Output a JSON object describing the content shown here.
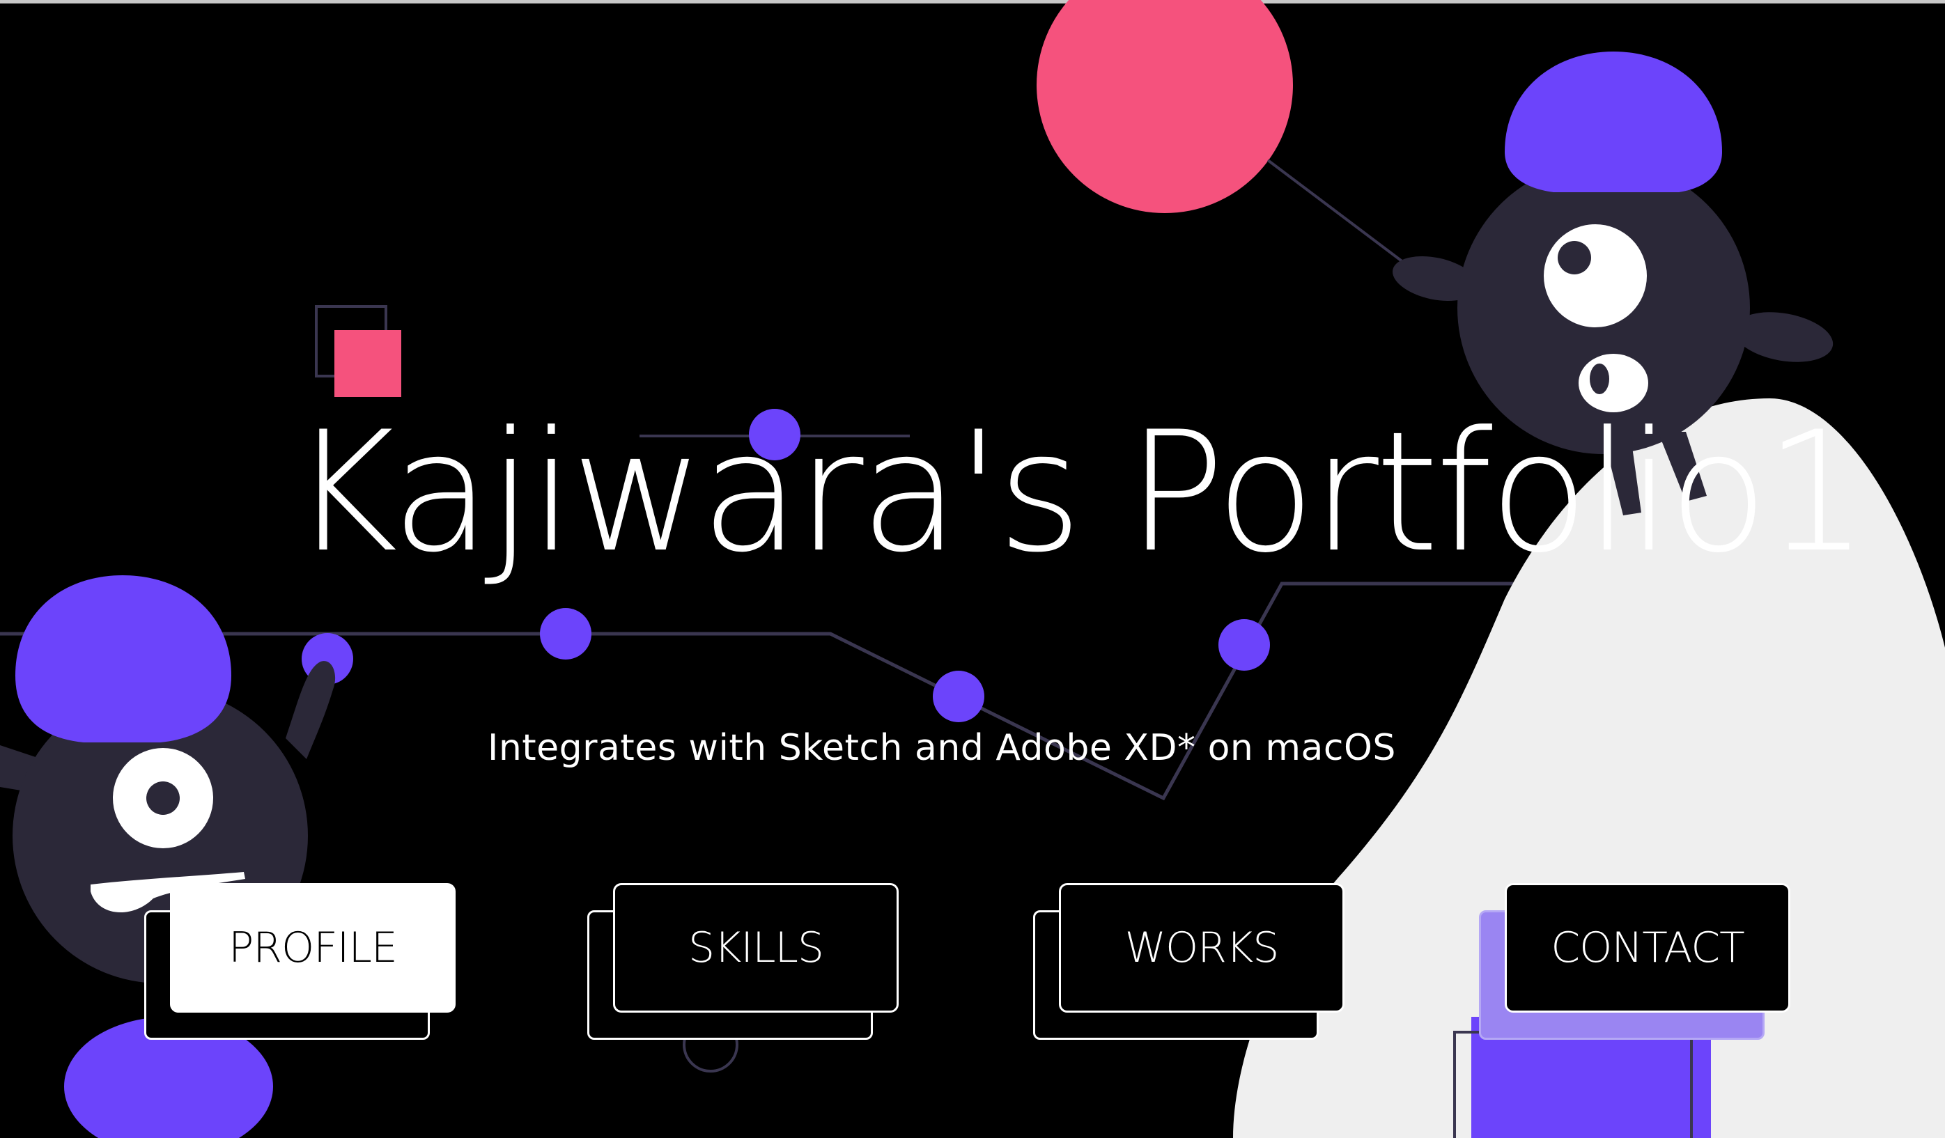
{
  "hero": {
    "title": "Kajiwara's Portfolio1",
    "subtitle": "Integrates with Sketch and Adobe XD* on macOS"
  },
  "nav": {
    "items": [
      {
        "label": "PROFILE",
        "style": "light"
      },
      {
        "label": "SKILLS",
        "style": "dark"
      },
      {
        "label": "WORKS",
        "style": "dark"
      },
      {
        "label": "CONTACT",
        "style": "contact"
      }
    ]
  },
  "colors": {
    "background": "#000000",
    "accent_purple": "#6c44fb",
    "accent_pink": "#f5527d",
    "character_body": "#2b2838",
    "hill": "#efefef",
    "contact_shadow": "#9a85f2",
    "line": "#3a3650"
  }
}
